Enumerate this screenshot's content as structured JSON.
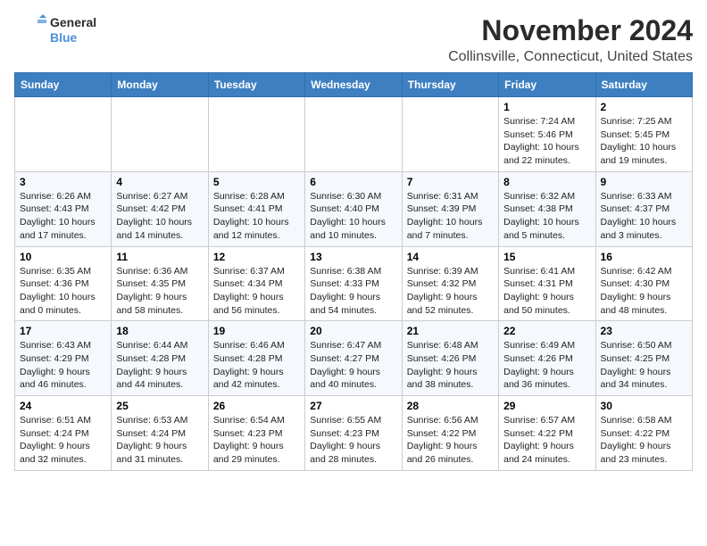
{
  "header": {
    "logo_line1": "General",
    "logo_line2": "Blue",
    "month_title": "November 2024",
    "location": "Collinsville, Connecticut, United States"
  },
  "days_of_week": [
    "Sunday",
    "Monday",
    "Tuesday",
    "Wednesday",
    "Thursday",
    "Friday",
    "Saturday"
  ],
  "weeks": [
    [
      {
        "num": "",
        "info": ""
      },
      {
        "num": "",
        "info": ""
      },
      {
        "num": "",
        "info": ""
      },
      {
        "num": "",
        "info": ""
      },
      {
        "num": "",
        "info": ""
      },
      {
        "num": "1",
        "info": "Sunrise: 7:24 AM\nSunset: 5:46 PM\nDaylight: 10 hours\nand 22 minutes."
      },
      {
        "num": "2",
        "info": "Sunrise: 7:25 AM\nSunset: 5:45 PM\nDaylight: 10 hours\nand 19 minutes."
      }
    ],
    [
      {
        "num": "3",
        "info": "Sunrise: 6:26 AM\nSunset: 4:43 PM\nDaylight: 10 hours\nand 17 minutes."
      },
      {
        "num": "4",
        "info": "Sunrise: 6:27 AM\nSunset: 4:42 PM\nDaylight: 10 hours\nand 14 minutes."
      },
      {
        "num": "5",
        "info": "Sunrise: 6:28 AM\nSunset: 4:41 PM\nDaylight: 10 hours\nand 12 minutes."
      },
      {
        "num": "6",
        "info": "Sunrise: 6:30 AM\nSunset: 4:40 PM\nDaylight: 10 hours\nand 10 minutes."
      },
      {
        "num": "7",
        "info": "Sunrise: 6:31 AM\nSunset: 4:39 PM\nDaylight: 10 hours\nand 7 minutes."
      },
      {
        "num": "8",
        "info": "Sunrise: 6:32 AM\nSunset: 4:38 PM\nDaylight: 10 hours\nand 5 minutes."
      },
      {
        "num": "9",
        "info": "Sunrise: 6:33 AM\nSunset: 4:37 PM\nDaylight: 10 hours\nand 3 minutes."
      }
    ],
    [
      {
        "num": "10",
        "info": "Sunrise: 6:35 AM\nSunset: 4:36 PM\nDaylight: 10 hours\nand 0 minutes."
      },
      {
        "num": "11",
        "info": "Sunrise: 6:36 AM\nSunset: 4:35 PM\nDaylight: 9 hours\nand 58 minutes."
      },
      {
        "num": "12",
        "info": "Sunrise: 6:37 AM\nSunset: 4:34 PM\nDaylight: 9 hours\nand 56 minutes."
      },
      {
        "num": "13",
        "info": "Sunrise: 6:38 AM\nSunset: 4:33 PM\nDaylight: 9 hours\nand 54 minutes."
      },
      {
        "num": "14",
        "info": "Sunrise: 6:39 AM\nSunset: 4:32 PM\nDaylight: 9 hours\nand 52 minutes."
      },
      {
        "num": "15",
        "info": "Sunrise: 6:41 AM\nSunset: 4:31 PM\nDaylight: 9 hours\nand 50 minutes."
      },
      {
        "num": "16",
        "info": "Sunrise: 6:42 AM\nSunset: 4:30 PM\nDaylight: 9 hours\nand 48 minutes."
      }
    ],
    [
      {
        "num": "17",
        "info": "Sunrise: 6:43 AM\nSunset: 4:29 PM\nDaylight: 9 hours\nand 46 minutes."
      },
      {
        "num": "18",
        "info": "Sunrise: 6:44 AM\nSunset: 4:28 PM\nDaylight: 9 hours\nand 44 minutes."
      },
      {
        "num": "19",
        "info": "Sunrise: 6:46 AM\nSunset: 4:28 PM\nDaylight: 9 hours\nand 42 minutes."
      },
      {
        "num": "20",
        "info": "Sunrise: 6:47 AM\nSunset: 4:27 PM\nDaylight: 9 hours\nand 40 minutes."
      },
      {
        "num": "21",
        "info": "Sunrise: 6:48 AM\nSunset: 4:26 PM\nDaylight: 9 hours\nand 38 minutes."
      },
      {
        "num": "22",
        "info": "Sunrise: 6:49 AM\nSunset: 4:26 PM\nDaylight: 9 hours\nand 36 minutes."
      },
      {
        "num": "23",
        "info": "Sunrise: 6:50 AM\nSunset: 4:25 PM\nDaylight: 9 hours\nand 34 minutes."
      }
    ],
    [
      {
        "num": "24",
        "info": "Sunrise: 6:51 AM\nSunset: 4:24 PM\nDaylight: 9 hours\nand 32 minutes."
      },
      {
        "num": "25",
        "info": "Sunrise: 6:53 AM\nSunset: 4:24 PM\nDaylight: 9 hours\nand 31 minutes."
      },
      {
        "num": "26",
        "info": "Sunrise: 6:54 AM\nSunset: 4:23 PM\nDaylight: 9 hours\nand 29 minutes."
      },
      {
        "num": "27",
        "info": "Sunrise: 6:55 AM\nSunset: 4:23 PM\nDaylight: 9 hours\nand 28 minutes."
      },
      {
        "num": "28",
        "info": "Sunrise: 6:56 AM\nSunset: 4:22 PM\nDaylight: 9 hours\nand 26 minutes."
      },
      {
        "num": "29",
        "info": "Sunrise: 6:57 AM\nSunset: 4:22 PM\nDaylight: 9 hours\nand 24 minutes."
      },
      {
        "num": "30",
        "info": "Sunrise: 6:58 AM\nSunset: 4:22 PM\nDaylight: 9 hours\nand 23 minutes."
      }
    ]
  ]
}
